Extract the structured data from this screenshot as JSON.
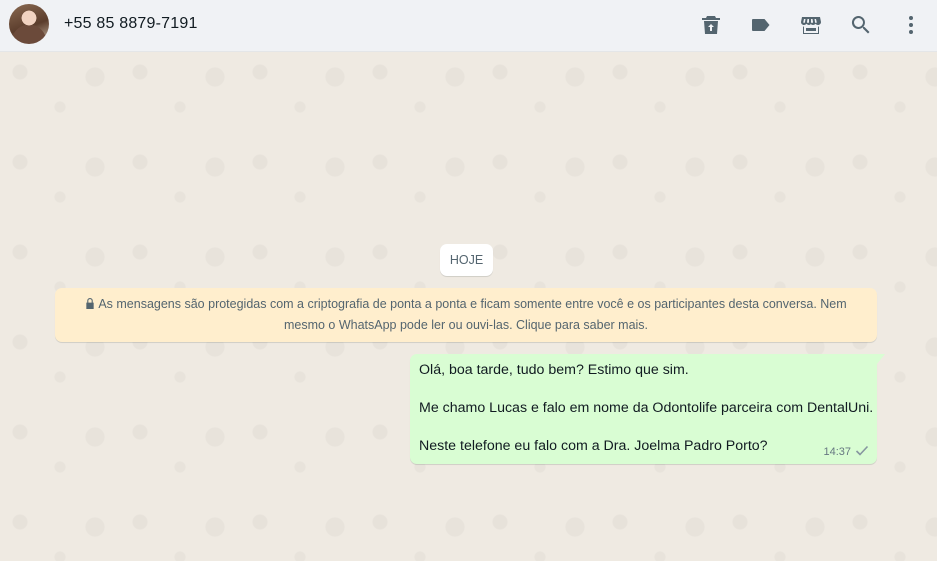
{
  "header": {
    "contact_name": "+55 85 8879-7191",
    "icons": [
      "delete-icon",
      "label-icon",
      "catalog-icon",
      "search-icon",
      "menu-icon"
    ]
  },
  "chat": {
    "date_chip": "HOJE",
    "encryption_notice": "As mensagens são protegidas com a criptografia de ponta a ponta e ficam somente entre você e os participantes desta conversa. Nem mesmo o WhatsApp pode ler ou ouvi-las. Clique para saber mais.",
    "message": {
      "lines": [
        "Olá, boa tarde, tudo bem? Estimo que sim.",
        "Me chamo Lucas e falo em nome da Odontolife parceira com DentalUni.",
        "Neste telefone eu falo com a Dra. Joelma Padro Porto?"
      ],
      "time": "14:37",
      "status": "sent"
    }
  },
  "colors": {
    "header_bg": "#f0f2f5",
    "chat_bg": "#efeae2",
    "outgoing_bubble": "#d9fdd3",
    "notice_bg": "#ffeecd",
    "icon": "#54656f"
  }
}
